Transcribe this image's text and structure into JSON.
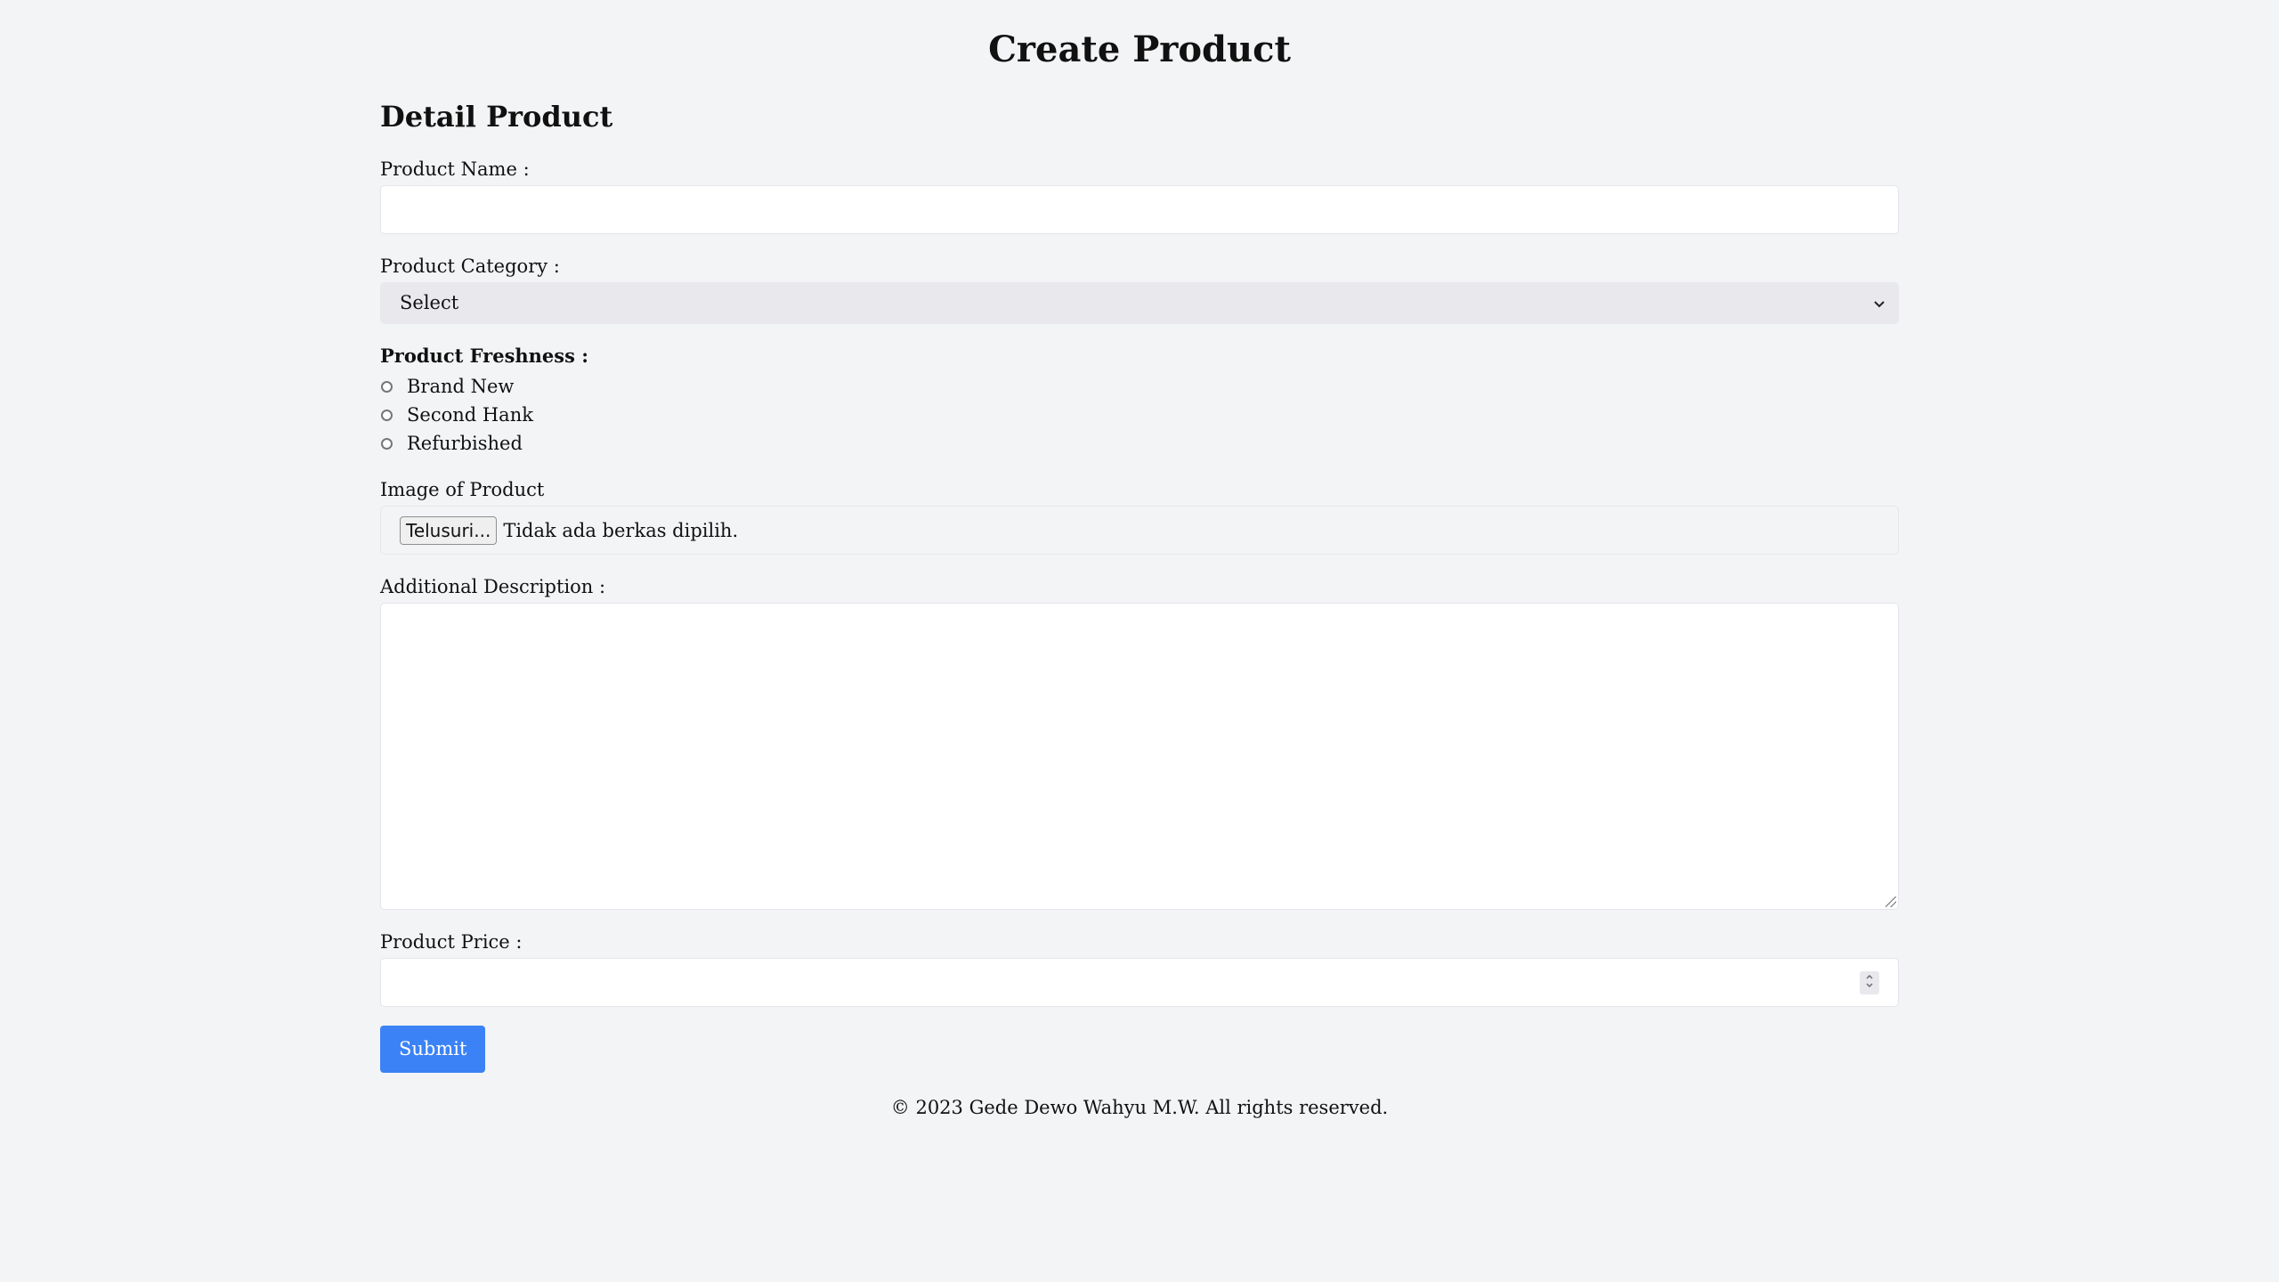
{
  "page": {
    "title": "Create Product"
  },
  "form": {
    "section_title": "Detail Product",
    "product_name": {
      "label": "Product Name :",
      "value": ""
    },
    "product_category": {
      "label": "Product Category :",
      "selected": "Select"
    },
    "product_freshness": {
      "label": "Product Freshness :",
      "options": [
        "Brand New",
        "Second Hank",
        "Refurbished"
      ],
      "selected": null
    },
    "image": {
      "label": "Image of Product",
      "button_label": "Telusuri...",
      "status": "Tidak ada berkas dipilih."
    },
    "description": {
      "label": "Additional Description :",
      "value": ""
    },
    "price": {
      "label": "Product Price :",
      "value": ""
    },
    "submit_label": "Submit"
  },
  "footer": {
    "text": "© 2023 Gede Dewo Wahyu M.W. All rights reserved."
  },
  "colors": {
    "background": "#f3f4f6",
    "submit_button": "#3b82f6",
    "select_background": "#e8e8ed"
  },
  "icons": {
    "select_arrow": "chevron-down-icon",
    "spinner": "number-spinner-icon",
    "resize": "resize-grip-icon"
  }
}
